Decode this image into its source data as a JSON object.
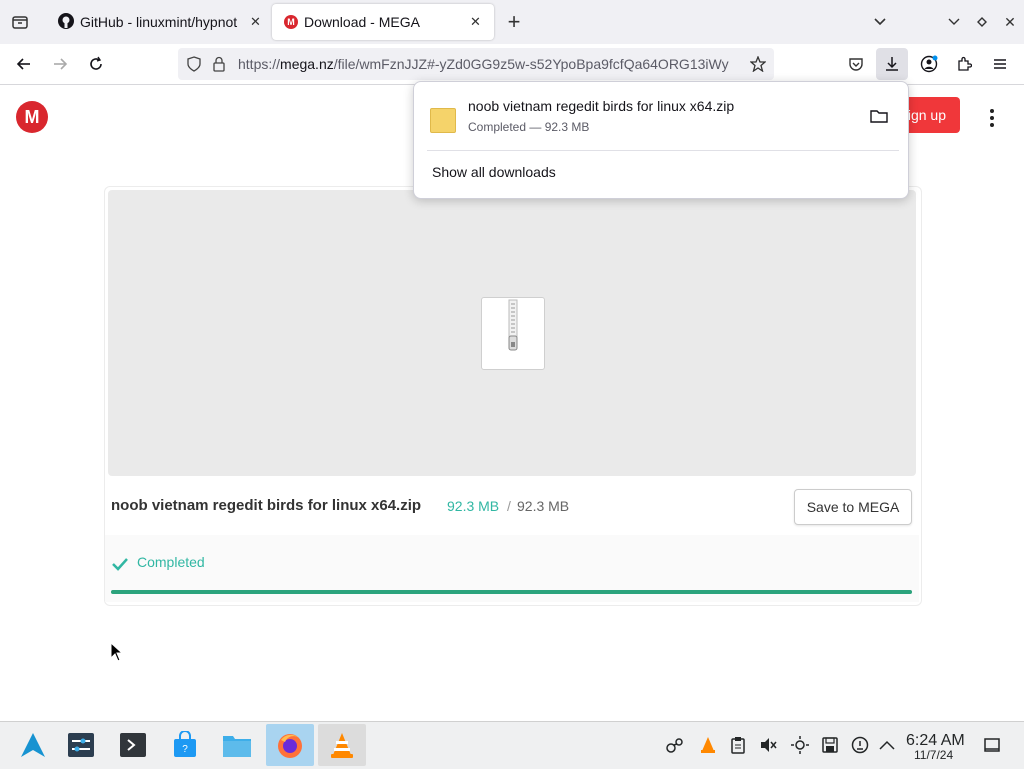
{
  "browser": {
    "tabs": [
      {
        "title": "GitHub - linuxmint/hypnot",
        "icon": "github-icon",
        "active": false
      },
      {
        "title": "Download - MEGA",
        "icon": "mega-icon",
        "active": true
      }
    ],
    "url": {
      "prefix": "https://",
      "host": "mega.nz",
      "path": "/file/wmFznJJZ#-yZd0GG9z5w-s52YpoBpa9fcfQa64ORG13iWy"
    }
  },
  "header": {
    "signup_label": "Sign up"
  },
  "download_popup": {
    "file_name": "noob vietnam regedit birds for linux x64.zip",
    "status": "Completed — 92.3 MB",
    "show_all_label": "Show all downloads"
  },
  "file": {
    "name": "noob vietnam regedit birds for linux x64.zip",
    "downloaded": "92.3 MB",
    "separator": "/",
    "total": "92.3 MB",
    "save_label": "Save to MEGA",
    "status": "Completed",
    "progress": 1.0
  },
  "taskbar": {
    "time": "6:24 AM",
    "date": "11/7/24"
  },
  "colors": {
    "accent": "#d9272e",
    "success": "#31b7a3",
    "progress": "#2ba37c"
  }
}
